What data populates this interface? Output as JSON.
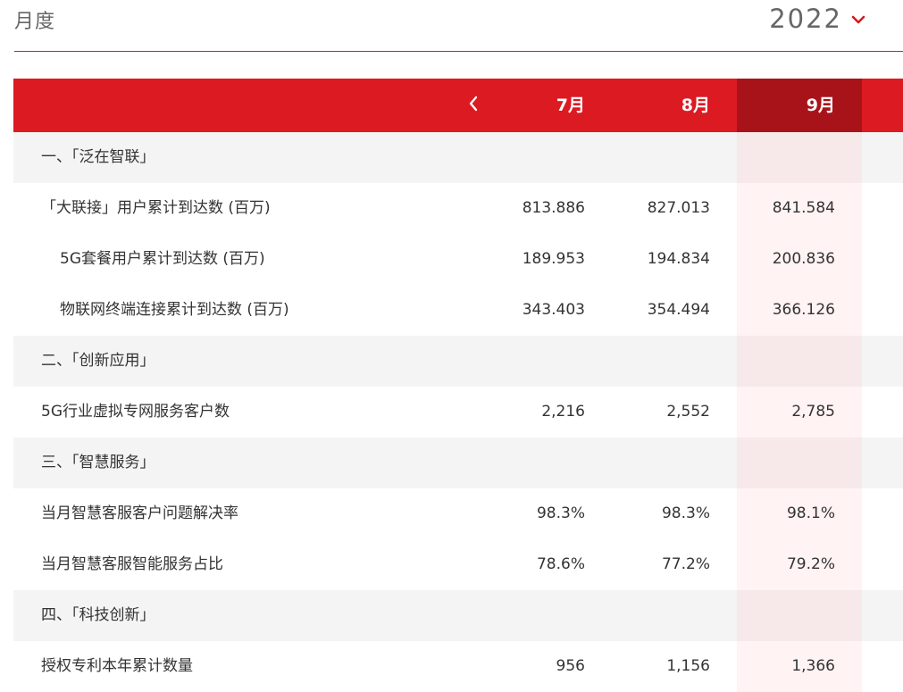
{
  "header": {
    "period_label": "月度",
    "year": "2022"
  },
  "icons": {
    "year_dropdown": "chevron-down-icon",
    "prev": "chevron-left-icon"
  },
  "colors": {
    "accent": "#db1a22",
    "accent_dark": "#a8131a",
    "highlight_row": "#fff3f3",
    "section_bg": "#f4f4f4"
  },
  "table": {
    "columns": [
      "7月",
      "8月",
      "9月"
    ],
    "selected_column": "9月",
    "rows": [
      {
        "type": "section",
        "label": "一、「泛在智联」"
      },
      {
        "type": "data",
        "label": "「大联接」用户累计到达数 (百万)",
        "indent": false,
        "values": [
          "813.886",
          "827.013",
          "841.584"
        ]
      },
      {
        "type": "data",
        "label": "5G套餐用户累计到达数 (百万)",
        "indent": true,
        "values": [
          "189.953",
          "194.834",
          "200.836"
        ]
      },
      {
        "type": "data",
        "label": "物联网终端连接累计到达数 (百万)",
        "indent": true,
        "values": [
          "343.403",
          "354.494",
          "366.126"
        ]
      },
      {
        "type": "section",
        "label": "二、「创新应用」"
      },
      {
        "type": "data",
        "label": "5G行业虚拟专网服务客户数",
        "indent": false,
        "values": [
          "2,216",
          "2,552",
          "2,785"
        ]
      },
      {
        "type": "section",
        "label": "三、「智慧服务」"
      },
      {
        "type": "data",
        "label": "当月智慧客服客户问题解决率",
        "indent": false,
        "values": [
          "98.3%",
          "98.3%",
          "98.1%"
        ]
      },
      {
        "type": "data",
        "label": "当月智慧客服智能服务占比",
        "indent": false,
        "values": [
          "78.6%",
          "77.2%",
          "79.2%"
        ]
      },
      {
        "type": "section",
        "label": "四、「科技创新」"
      },
      {
        "type": "data",
        "label": "授权专利本年累计数量",
        "indent": false,
        "values": [
          "956",
          "1,156",
          "1,366"
        ]
      }
    ]
  }
}
